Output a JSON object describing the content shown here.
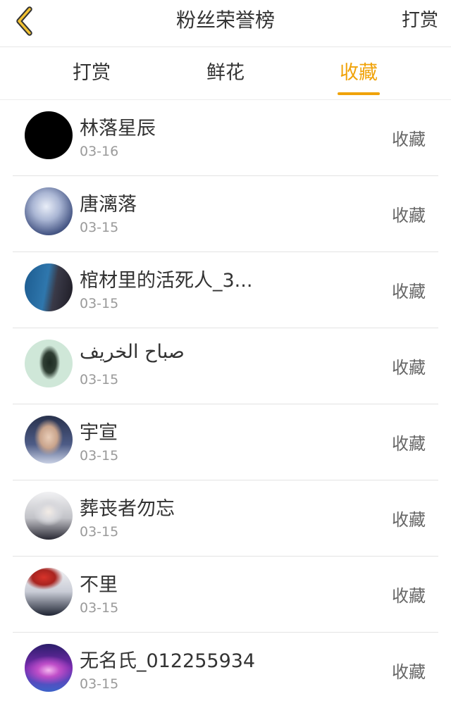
{
  "header": {
    "back_icon": "chevron-left-icon",
    "title": "粉丝荣誉榜",
    "right_link": "打赏"
  },
  "tabs": [
    {
      "label": "打赏",
      "active": false
    },
    {
      "label": "鲜花",
      "active": false
    },
    {
      "label": "收藏",
      "active": true
    }
  ],
  "colors": {
    "accent": "#f0a30a",
    "text": "#333333",
    "muted": "#9a9a9a"
  },
  "fans": [
    {
      "name": "林落星辰",
      "date": "03-16",
      "action": "收藏",
      "avatar": "black-circle"
    },
    {
      "name": "唐漓落",
      "date": "03-15",
      "action": "收藏",
      "avatar": "frost-illustration"
    },
    {
      "name": "棺材里的活死人_3...",
      "date": "03-15",
      "action": "收藏",
      "avatar": "window-silhouette"
    },
    {
      "name": "صباح الخريف",
      "date": "03-15",
      "action": "收藏",
      "avatar": "insect-on-mint"
    },
    {
      "name": "宇宣",
      "date": "03-15",
      "action": "收藏",
      "avatar": "portrait"
    },
    {
      "name": "葬丧者勿忘",
      "date": "03-15",
      "action": "收藏",
      "avatar": "anime-silver-hair"
    },
    {
      "name": "不里",
      "date": "03-15",
      "action": "收藏",
      "avatar": "anime-red-hair"
    },
    {
      "name": "无名氏_012255934",
      "date": "03-15",
      "action": "收藏",
      "avatar": "purple-galaxy"
    }
  ]
}
